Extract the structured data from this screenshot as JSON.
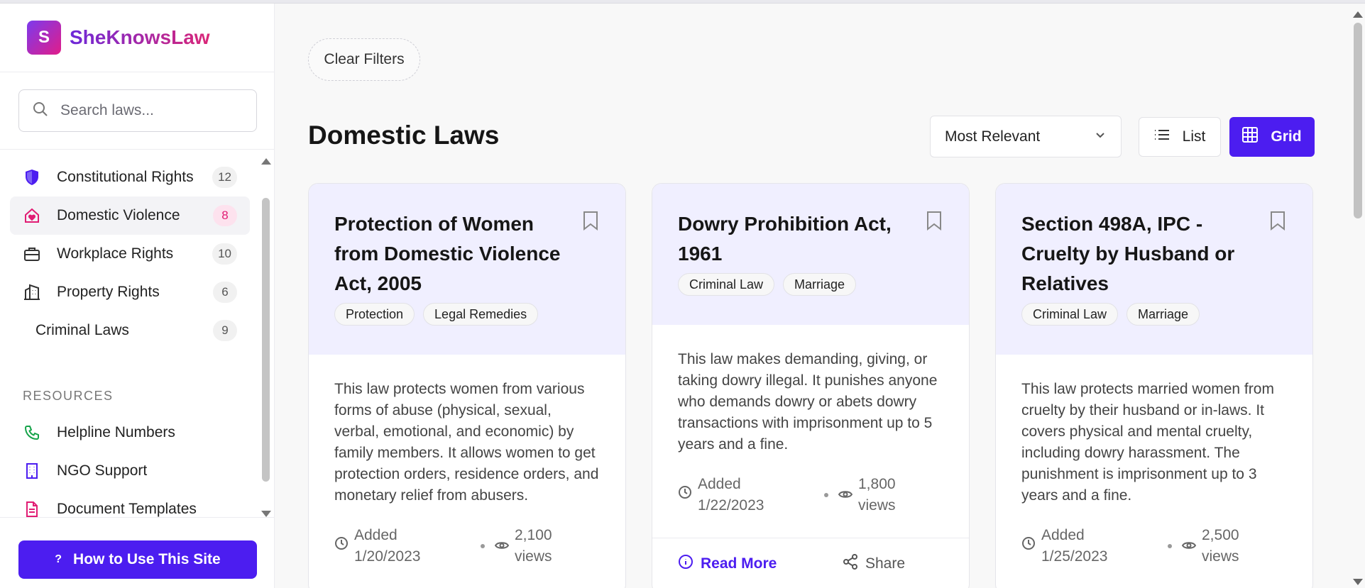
{
  "brand": {
    "logo_letter": "S",
    "name": "SheKnowsLaw"
  },
  "search": {
    "placeholder": "Search laws..."
  },
  "categories": [
    {
      "label": "Constitutional Rights",
      "count": "12",
      "icon": "shield-icon",
      "active": false
    },
    {
      "label": "Domestic Violence",
      "count": "8",
      "icon": "home-heart-icon",
      "active": true
    },
    {
      "label": "Workplace Rights",
      "count": "10",
      "icon": "briefcase-icon",
      "active": false
    },
    {
      "label": "Property Rights",
      "count": "6",
      "icon": "building-icon",
      "active": false
    },
    {
      "label": "Criminal Laws",
      "count": "9",
      "icon": "",
      "active": false
    }
  ],
  "resources": {
    "title": "RESOURCES",
    "items": [
      {
        "label": "Helpline Numbers",
        "icon": "phone-icon"
      },
      {
        "label": "NGO Support",
        "icon": "office-building-icon"
      },
      {
        "label": "Document Templates",
        "icon": "document-icon"
      }
    ]
  },
  "help_button": {
    "icon": "?",
    "label": "How to Use This Site"
  },
  "filters": {
    "clear_label": "Clear Filters"
  },
  "page": {
    "title": "Domestic Laws"
  },
  "sort": {
    "selected": "Most Relevant"
  },
  "view": {
    "list_label": "List",
    "grid_label": "Grid",
    "active": "grid"
  },
  "colors": {
    "accent": "#4c1df0",
    "pink": "#e11d74",
    "card_header": "#f0efff"
  },
  "laws": [
    {
      "title": "Protection of Women from Domestic Violence Act, 2005",
      "tags": [
        "Protection",
        "Legal Remedies"
      ],
      "description": "This law protects women from various forms of abuse (physical, sexual, verbal, emotional, and economic) by family members. It allows women to get protection orders, residence orders, and monetary relief from abusers.",
      "added": "Added 1/20/2023",
      "views": "2,100 views"
    },
    {
      "title": "Dowry Prohibition Act, 1961",
      "tags": [
        "Criminal Law",
        "Marriage"
      ],
      "description": "This law makes demanding, giving, or taking dowry illegal. It punishes anyone who demands dowry or abets dowry transactions with imprisonment up to 5 years and a fine.",
      "added": "Added 1/22/2023",
      "views": "1,800 views",
      "read_more": "Read More",
      "share": "Share"
    },
    {
      "title": "Section 498A, IPC - Cruelty by Husband or Relatives",
      "tags": [
        "Criminal Law",
        "Marriage"
      ],
      "description": "This law protects married women from cruelty by their husband or in-laws. It covers physical and mental cruelty, including dowry harassment. The punishment is imprisonment up to 3 years and a fine.",
      "added": "Added 1/25/2023",
      "views": "2,500 views"
    }
  ]
}
